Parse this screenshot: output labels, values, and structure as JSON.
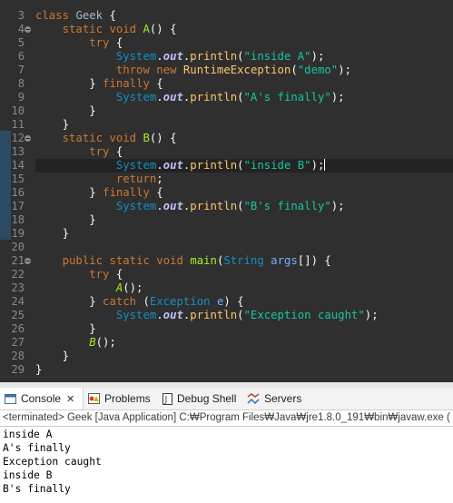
{
  "editor": {
    "line_numbers": [
      "3",
      "4",
      "5",
      "6",
      "7",
      "8",
      "9",
      "10",
      "11",
      "12",
      "13",
      "14",
      "15",
      "16",
      "17",
      "18",
      "19",
      "20",
      "21",
      "22",
      "23",
      "24",
      "25",
      "26",
      "27",
      "28",
      "29"
    ],
    "tokens": {
      "l3": [
        "class",
        " ",
        "Geek",
        " {"
      ],
      "l4": [
        "    ",
        "static",
        " ",
        "void",
        " ",
        "A",
        "() {"
      ],
      "l5": [
        "        ",
        "try",
        " {"
      ],
      "l6": [
        "            ",
        "System",
        ".",
        "out",
        ".",
        "println",
        "(",
        "\"inside A\"",
        ");"
      ],
      "l7": [
        "            ",
        "throw",
        " ",
        "new",
        " ",
        "RuntimeException",
        "(",
        "\"demo\"",
        ");"
      ],
      "l8": [
        "        } ",
        "finally",
        " {"
      ],
      "l9": [
        "            ",
        "System",
        ".",
        "out",
        ".",
        "println",
        "(",
        "\"A's finally\"",
        ");"
      ],
      "l10": [
        "        }"
      ],
      "l11": [
        "    }"
      ],
      "l12": [
        "    ",
        "static",
        " ",
        "void",
        " ",
        "B",
        "() {"
      ],
      "l13": [
        "        ",
        "try",
        " {"
      ],
      "l14": [
        "            ",
        "System",
        ".",
        "out",
        ".",
        "println",
        "(",
        "\"inside B\"",
        ");"
      ],
      "l15": [
        "            ",
        "return",
        ";"
      ],
      "l16": [
        "        } ",
        "finally",
        " {"
      ],
      "l17": [
        "            ",
        "System",
        ".",
        "out",
        ".",
        "println",
        "(",
        "\"B's finally\"",
        ");"
      ],
      "l18": [
        "        }"
      ],
      "l19": [
        "    }"
      ],
      "l20": [
        ""
      ],
      "l21": [
        "    ",
        "public",
        " ",
        "static",
        " ",
        "void",
        " ",
        "main",
        "(",
        "String",
        " ",
        "args",
        "[]) {"
      ],
      "l22": [
        "        ",
        "try",
        " {"
      ],
      "l23": [
        "            ",
        "A",
        "();"
      ],
      "l24": [
        "        } ",
        "catch",
        " (",
        "Exception",
        " ",
        "e",
        ") {"
      ],
      "l25": [
        "            ",
        "System",
        ".",
        "out",
        ".",
        "println",
        "(",
        "\"Exception caught\"",
        ");"
      ],
      "l26": [
        "        }"
      ],
      "l27": [
        "        ",
        "B",
        "();"
      ],
      "l28": [
        "    }"
      ],
      "l29": [
        "}"
      ]
    }
  },
  "console_tabs": {
    "console": "Console",
    "console_close": "✕",
    "problems": "Problems",
    "javadoc": "Debug Shell",
    "servers": "Servers"
  },
  "terminated_text": "<terminated> Geek [Java Application] C:₩Program Files₩Java₩jre1.8.0_191₩bin₩javaw.exe (",
  "console_output": [
    "inside A",
    "A's finally",
    "Exception caught",
    "inside B",
    "B's finally"
  ],
  "colors": {
    "editor_bg": "#2f2f2f",
    "keyword": "#cc7832",
    "string": "#17c6a3",
    "method": "#a7ec21",
    "system": "#1290c3"
  }
}
